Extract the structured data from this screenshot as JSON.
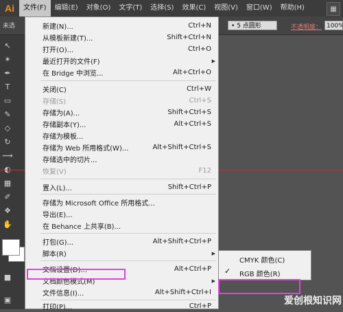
{
  "app": {
    "logo": "Ai"
  },
  "menubar": {
    "items": [
      "文件(F)",
      "编辑(E)",
      "对象(O)",
      "文字(T)",
      "选择(S)",
      "效果(C)",
      "视图(V)",
      "窗口(W)",
      "帮助(H)"
    ],
    "active_index": 0
  },
  "control_bar": {
    "left_text": "未选",
    "brush_label": "5 点圆形",
    "opacity_label": "不透明度：",
    "opacity_value": "100%"
  },
  "file_menu": [
    {
      "label": "新建(N)...",
      "shortcut": "Ctrl+N",
      "enabled": true,
      "submenu": false
    },
    {
      "label": "从模板新建(T)...",
      "shortcut": "Shift+Ctrl+N",
      "enabled": true,
      "submenu": false
    },
    {
      "label": "打开(O)...",
      "shortcut": "Ctrl+O",
      "enabled": true,
      "submenu": false
    },
    {
      "label": "最近打开的文件(F)",
      "shortcut": "",
      "enabled": true,
      "submenu": true
    },
    {
      "label": "在 Bridge 中浏览...",
      "shortcut": "Alt+Ctrl+O",
      "enabled": true,
      "submenu": false
    },
    {
      "label": "关闭(C)",
      "shortcut": "Ctrl+W",
      "enabled": true,
      "submenu": false
    },
    {
      "label": "存储(S)",
      "shortcut": "Ctrl+S",
      "enabled": false,
      "submenu": false
    },
    {
      "label": "存储为(A)...",
      "shortcut": "Shift+Ctrl+S",
      "enabled": true,
      "submenu": false
    },
    {
      "label": "存储副本(Y)...",
      "shortcut": "Alt+Ctrl+S",
      "enabled": true,
      "submenu": false
    },
    {
      "label": "存储为模板...",
      "shortcut": "",
      "enabled": true,
      "submenu": false
    },
    {
      "label": "存储为 Web 所用格式(W)...",
      "shortcut": "Alt+Shift+Ctrl+S",
      "enabled": true,
      "submenu": false
    },
    {
      "label": "存储选中的切片...",
      "shortcut": "",
      "enabled": true,
      "submenu": false
    },
    {
      "label": "恢复(V)",
      "shortcut": "F12",
      "enabled": false,
      "submenu": false
    },
    {
      "label": "置入(L)...",
      "shortcut": "Shift+Ctrl+P",
      "enabled": true,
      "submenu": false
    },
    {
      "label": "存储为 Microsoft Office 所用格式...",
      "shortcut": "",
      "enabled": true,
      "submenu": false
    },
    {
      "label": "导出(E)...",
      "shortcut": "",
      "enabled": true,
      "submenu": false
    },
    {
      "label": "在 Behance 上共享(B)...",
      "shortcut": "",
      "enabled": true,
      "submenu": false
    },
    {
      "label": "打包(G)...",
      "shortcut": "Alt+Shift+Ctrl+P",
      "enabled": true,
      "submenu": false
    },
    {
      "label": "脚本(R)",
      "shortcut": "",
      "enabled": true,
      "submenu": true
    },
    {
      "label": "文档设置(D)...",
      "shortcut": "Alt+Ctrl+P",
      "enabled": true,
      "submenu": false
    },
    {
      "label": "文档颜色模式(M)",
      "shortcut": "",
      "enabled": true,
      "submenu": true
    },
    {
      "label": "文件信息(I)...",
      "shortcut": "Alt+Shift+Ctrl+I",
      "enabled": true,
      "submenu": false
    },
    {
      "label": "打印(P)...",
      "shortcut": "Ctrl+P",
      "enabled": true,
      "submenu": false
    }
  ],
  "color_mode_submenu": [
    {
      "label": "CMYK 颜色(C)",
      "checked": false
    },
    {
      "label": "RGB 颜色(R)",
      "checked": true
    }
  ],
  "highlight_color": "#e23fe6",
  "watermark": "爱创根知识网"
}
